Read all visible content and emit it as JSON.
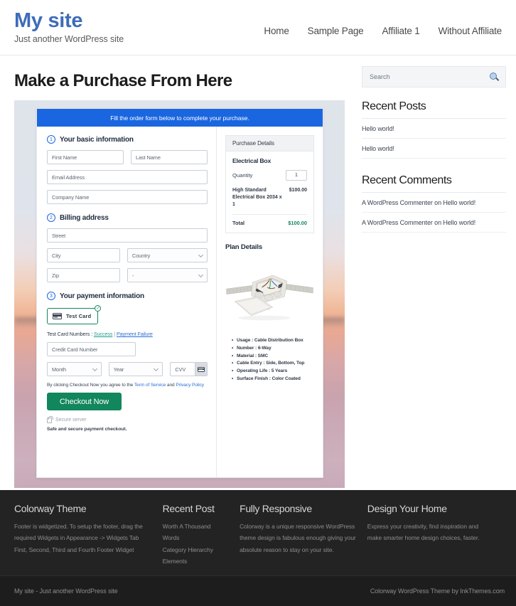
{
  "header": {
    "site_title": "My site",
    "tagline": "Just another WordPress site",
    "nav": [
      {
        "label": "Home"
      },
      {
        "label": "Sample Page"
      },
      {
        "label": "Affiliate 1"
      },
      {
        "label": "Without Affiliate"
      }
    ]
  },
  "main": {
    "page_title": "Make a Purchase From Here",
    "checkout": {
      "banner": "Fill the order form below to complete your purchase.",
      "step1": {
        "number": "1",
        "title": "Your basic information",
        "first_name": "First Name",
        "last_name": "Last Name",
        "email": "Email Address",
        "company": "Company Name"
      },
      "step2": {
        "number": "2",
        "title": "Billing address",
        "street": "Street",
        "city": "City",
        "country": "Country",
        "zip": "Zip",
        "state": "-"
      },
      "step3": {
        "number": "3",
        "title": "Your payment information",
        "test_card_label": "Test Card",
        "tick": "✓",
        "test_numbers_prefix": "Test Card Numbers : ",
        "link_success": "Success",
        "link_separator": " | ",
        "link_failure": "Payment Failure",
        "card_number": "Credit Card Number",
        "month": "Month",
        "year": "Year",
        "cvv": "CVV"
      },
      "agree_prefix": "By clicking Checkout Now you agree to the ",
      "agree_tos": "Term of Service",
      "agree_and": " and ",
      "agree_privacy": "Privacy Policy",
      "checkout_button": "Checkout Now",
      "secure_server": "Secure server",
      "safe_note": "Safe and secure payment checkout."
    },
    "purchase_details": {
      "heading": "Purchase Details",
      "product": "Electrical Box",
      "quantity_label": "Quantity",
      "quantity_value": "1",
      "line_desc": "High Standard Electrical Box 2034 x 1",
      "line_amount": "$100.00",
      "total_label": "Total",
      "total_amount": "$100.00",
      "total_color": "#12865c"
    },
    "plan_details": {
      "heading": "Plan Details",
      "image_alt": "electrical-junction-box-photo",
      "bullets": [
        "Usage : Cable Distribution Box",
        "Number : 6-Way",
        "Material : SMC",
        "Cable Entry : Side, Bottom, Top",
        "Operating Life : 5 Years",
        "Surface Finish : Color Coated"
      ]
    }
  },
  "sidebar": {
    "search_placeholder": "Search",
    "recent_posts": {
      "title": "Recent Posts",
      "items": [
        {
          "label": "Hello world!"
        },
        {
          "label": "Hello world!"
        }
      ]
    },
    "recent_comments": {
      "title": "Recent Comments",
      "items": [
        {
          "label": "A WordPress Commenter on Hello world!"
        },
        {
          "label": "A WordPress Commenter on Hello world!"
        }
      ]
    }
  },
  "footer": {
    "columns": [
      {
        "title": "Colorway Theme",
        "text": "Footer is widgetized. To setup the footer, drag the required Widgets in Appearance -> Widgets Tab First, Second, Third and Fourth Footer Widget"
      },
      {
        "title": "Recent Post",
        "items": [
          {
            "label": "Worth A Thousand Words"
          },
          {
            "label": "Category Hierarchy"
          },
          {
            "label": "Elements"
          }
        ]
      },
      {
        "title": "Fully Responsive",
        "text": "Colorway is a unique responsive WordPress theme design is fabulous enough giving your absolute reason to stay on your site."
      },
      {
        "title": "Design Your Home",
        "text": "Express your creativity, find inspiration and make smarter home design choices, faster."
      }
    ],
    "bottom_left": "My site - Just another WordPress site",
    "bottom_right": "Colorway WordPress Theme by InkThemes.com"
  },
  "theme": {
    "brand_blue": "#3d6cb9",
    "banner_blue": "#1a66e0",
    "accent_green": "#12865c",
    "footer_bg": "#232323"
  }
}
